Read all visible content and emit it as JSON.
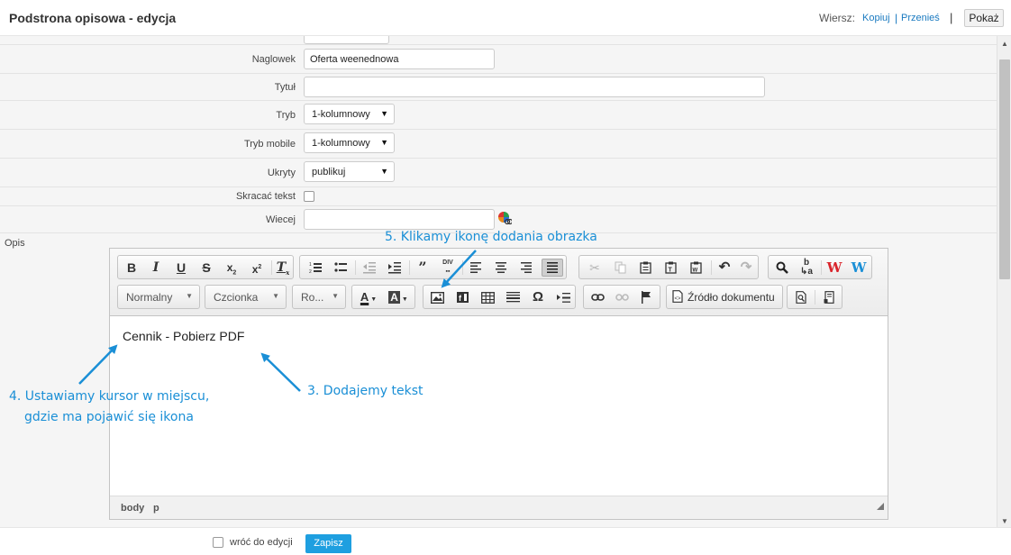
{
  "header": {
    "title": "Podstrona opisowa - edycja",
    "row_label": "Wiersz:",
    "copy_link": "Kopiuj",
    "move_link": "Przenieś",
    "separator": "|",
    "show_button": "Pokaż"
  },
  "form": {
    "naglowek": {
      "label": "Naglowek",
      "value": "Oferta weenednowa"
    },
    "tytul": {
      "label": "Tytuł",
      "value": ""
    },
    "tryb": {
      "label": "Tryb",
      "value": "1-kolumnowy"
    },
    "tryb_mobile": {
      "label": "Tryb mobile",
      "value": "1-kolumnowy"
    },
    "ukryty": {
      "label": "Ukryty",
      "value": "publikuj"
    },
    "skracac": {
      "label": "Skracać tekst",
      "checked": false
    },
    "wiecej": {
      "label": "Wiecej",
      "value": ""
    },
    "opis": {
      "label": "Opis"
    }
  },
  "editor": {
    "format_combo": "Normalny",
    "font_combo": "Czcionka",
    "size_combo": "Ro...",
    "source_button": "Źródło dokumentu",
    "content_text": "Cennik - Pobierz PDF",
    "status_path": [
      "body",
      "p"
    ],
    "icons_row1": [
      "bold-icon",
      "italic-icon",
      "underline-icon",
      "strike-icon",
      "subscript-icon",
      "superscript-icon",
      "remove-format-icon",
      "numbered-list-icon",
      "bulleted-list-icon",
      "outdent-icon",
      "indent-icon",
      "blockquote-icon",
      "div-icon",
      "align-left-icon",
      "align-center-icon",
      "align-right-icon",
      "justify-icon",
      "cut-icon",
      "copy-icon",
      "paste-icon",
      "paste-text-icon",
      "paste-word-icon",
      "undo-icon",
      "redo-icon",
      "find-icon",
      "replace-icon",
      "w-red-icon",
      "w-blue-icon"
    ],
    "icons_row2": [
      "text-color-icon",
      "bg-color-icon",
      "image-icon",
      "flash-icon",
      "table-icon",
      "horizontal-rule-icon",
      "special-char-icon",
      "page-break-icon",
      "link-icon",
      "unlink-icon",
      "anchor-icon",
      "source-icon",
      "preview-icon",
      "templates-icon"
    ]
  },
  "annotations": {
    "step3": "3. Dodajemy tekst",
    "step4_line1": "4. Ustawiamy kursor w miejscu,",
    "step4_line2": "gdzie ma pojawić się ikona",
    "step5": "5. Klikamy ikonę dodania obrazka",
    "color": "#1a8fd6"
  },
  "footer": {
    "back_label": "wróć do edycji",
    "save_button": "Zapisz"
  },
  "colors": {
    "accent": "#1e9fe0",
    "link": "#1a7ac0",
    "w_red": "#d9242b",
    "w_blue": "#1a8fd6"
  }
}
